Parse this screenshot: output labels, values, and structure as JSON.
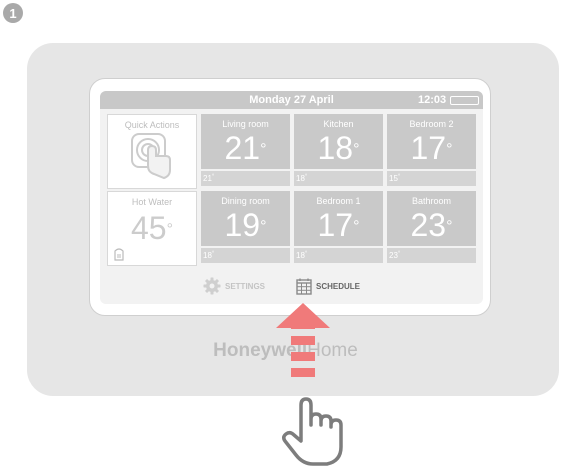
{
  "step_number": "1",
  "status_bar": {
    "date": "Monday 27 April",
    "time": "12:03"
  },
  "tiles": {
    "quick_actions": {
      "label": "Quick Actions"
    },
    "hot_water": {
      "label": "Hot Water",
      "temp": "45"
    },
    "zones": [
      {
        "label": "Living room",
        "temp": "21",
        "setpoint": "21"
      },
      {
        "label": "Kitchen",
        "temp": "18",
        "setpoint": "18"
      },
      {
        "label": "Bedroom 2",
        "temp": "17",
        "setpoint": "15"
      },
      {
        "label": "Dining room",
        "temp": "19",
        "setpoint": "18"
      },
      {
        "label": "Bedroom 1",
        "temp": "17",
        "setpoint": "18"
      },
      {
        "label": "Bathroom",
        "temp": "23",
        "setpoint": "23"
      }
    ]
  },
  "nav": {
    "settings_label": "SETTINGS",
    "schedule_label": "SCHEDULE"
  },
  "brand": {
    "bold": "Honeywell",
    "light": "Home"
  },
  "colors": {
    "arrow": "#f07a7a",
    "screen_grey": "#c9c9c9",
    "device": "#e6e6e6"
  },
  "icons": [
    "touch-icon",
    "water-cylinder-icon",
    "gear-icon",
    "calendar-icon",
    "up-arrow-icon",
    "pointing-hand-icon",
    "battery-icon"
  ]
}
